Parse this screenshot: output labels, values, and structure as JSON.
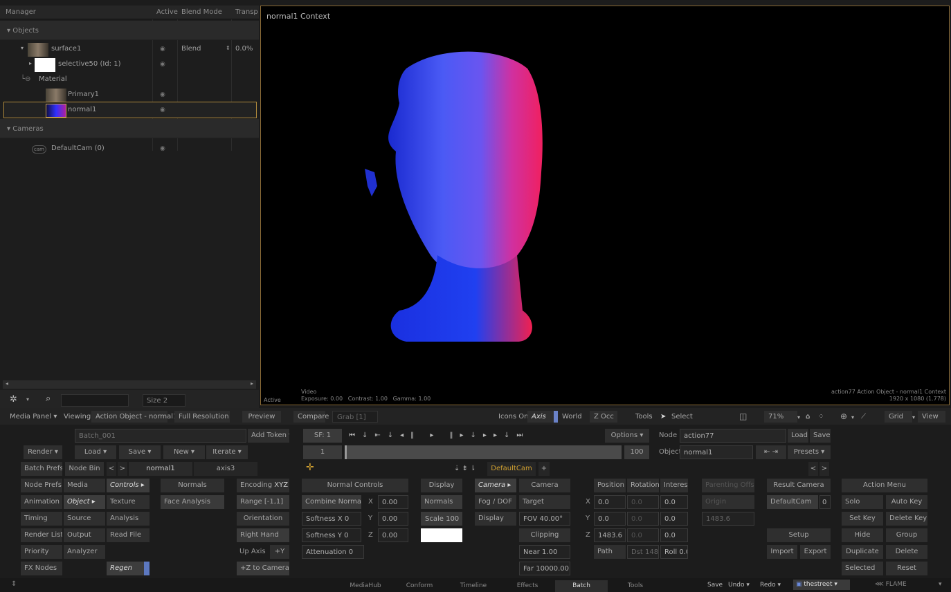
{
  "manager": {
    "headers": [
      "Manager",
      "Active",
      "Blend Mode",
      "Transp"
    ],
    "objects_group": "Objects",
    "surface_label": "surface1",
    "surface_blend": "Blend",
    "surface_transp": "0.0%",
    "selective_label": "selective50 (Id: 1)",
    "material_label": "Material",
    "primary_label": "Primary1",
    "normal_label": "normal1",
    "cameras_group": "Cameras",
    "camera_label": "DefaultCam (0)",
    "size_value": "Size 2"
  },
  "viewport": {
    "title": "normal1 Context",
    "video_label": "Video",
    "exposure": "Exposure: 0.00",
    "contrast": "Contrast: 1.00",
    "gamma": "Gamma: 1.00",
    "active": "Active",
    "context_info": "action77 Action Object - normal1 Context",
    "resolution": "1920 x 1080 (1.778)"
  },
  "topbar": {
    "media_panel": "Media Panel",
    "viewing": "Viewing",
    "viewing_value": "Action Object - normal1",
    "full_res": "Full Resolution",
    "preview": "Preview",
    "compare": "Compare",
    "grab": "Grab [1]",
    "icons_on": "Icons On",
    "axis": "Axis",
    "world": "World",
    "zocc": "Z Occ",
    "tools": "Tools",
    "select": "Select",
    "zoom": "71%",
    "grid": "Grid",
    "view": "View"
  },
  "batch": {
    "name": "Batch_001",
    "add_token": "Add Token",
    "render": "Render",
    "load": "Load",
    "save": "Save",
    "new": "New",
    "iterate": "Iterate",
    "batch_prefs": "Batch Prefs",
    "node_bin": "Node Bin",
    "tab_normal": "normal1",
    "tab_axis": "axis3"
  },
  "timeline": {
    "sf": "SF: 1",
    "options": "Options",
    "frame": "1",
    "end": "100",
    "camera_tab": "DefaultCam",
    "node_label": "Node",
    "node_value": "action77",
    "object_label": "Object",
    "object_value": "normal1",
    "load": "Load",
    "save": "Save",
    "presets": "Presets"
  },
  "left_menu": {
    "node_prefs": "Node Prefs",
    "media": "Media",
    "controls": "Controls",
    "animation": "Animation",
    "object": "Object",
    "texture": "Texture",
    "timing": "Timing",
    "source": "Source",
    "analysis": "Analysis",
    "render_list": "Render List",
    "output": "Output",
    "read_file": "Read File",
    "priority": "Priority",
    "analyzer": "Analyzer",
    "fx_nodes": "FX Nodes",
    "regen": "Regen"
  },
  "normals": {
    "header": "Normals",
    "face_analysis": "Face Analysis",
    "encoding": "Encoding",
    "encoding_value": "XYZ",
    "range": "Range [-1,1]",
    "orientation": "Orientation",
    "right_hand": "Right Hand",
    "up_axis": "Up Axis",
    "up_axis_value": "+Y",
    "z_to_camera": "+Z to Camera",
    "normal_controls": "Normal Controls",
    "combine_normals": "Combine Normals",
    "softness_x": "Softness X 0",
    "softness_y": "Softness Y 0",
    "attenuation": "Attenuation 0",
    "x_label": "X",
    "y_label": "Y",
    "z_label": "Z",
    "x_val": "0.00",
    "y_val": "0.00",
    "z_val": "0.00",
    "display_header": "Display",
    "normals_btn": "Normals",
    "scale": "Scale 100"
  },
  "camera": {
    "camera_menu": "Camera",
    "camera_header": "Camera",
    "fog_dof": "Fog / DOF",
    "target": "Target",
    "display": "Display",
    "fov": "FOV 40.00°",
    "clipping": "Clipping",
    "near": "Near 1.00",
    "far": "Far 10000.00",
    "position": "Position",
    "rotation": "Rotation",
    "interest": "Interest",
    "px": "0.0",
    "rx": "0.0",
    "ix": "0.0",
    "py": "0.0",
    "ry": "0.0",
    "iy": "0.0",
    "pz": "1483.6",
    "rz": "0.0",
    "iz": "0.0",
    "path": "Path",
    "dst": "Dst 1483",
    "roll": "Roll 0.00",
    "parenting_offset": "Parenting Offset",
    "origin": "Origin",
    "origin_value": "1483.6",
    "result_camera": "Result Camera",
    "result_value": "DefaultCam",
    "result_index": "0",
    "setup": "Setup",
    "import": "Import",
    "export": "Export"
  },
  "action_menu": {
    "header": "Action Menu",
    "solo": "Solo",
    "auto_key": "Auto Key",
    "set_key": "Set Key",
    "delete_key": "Delete Key",
    "hide": "Hide",
    "group": "Group",
    "duplicate": "Duplicate",
    "delete": "Delete",
    "selected": "Selected",
    "reset": "Reset"
  },
  "bottom": {
    "tabs": [
      "MediaHub",
      "Conform",
      "Timeline",
      "Effects",
      "Batch",
      "Tools"
    ],
    "save": "Save",
    "undo": "Undo",
    "redo": "Redo",
    "user": "thestreet",
    "brand": "FLAME"
  }
}
